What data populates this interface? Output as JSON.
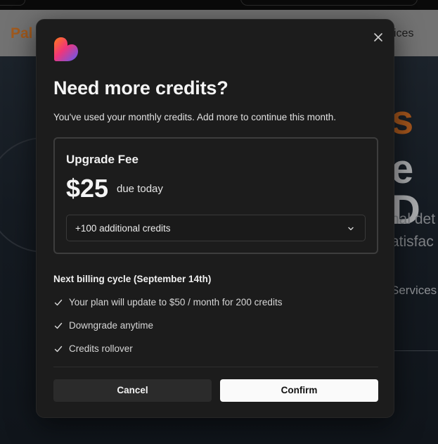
{
  "background": {
    "brand": "Pal",
    "nav_link": "ices",
    "hero_heading_1": "s",
    "hero_heading_2": "e D",
    "hero_body_1": "nal det",
    "hero_body_2": "atisfac",
    "hero_link": "Services"
  },
  "modal": {
    "title": "Need more credits?",
    "subtitle": "You've used your monthly credits. Add more to continue this month.",
    "fee_card": {
      "label": "Upgrade Fee",
      "amount": "$25",
      "due_text": "due today",
      "credits_option": "+100 additional credits"
    },
    "billing": {
      "title": "Next billing cycle (September 14th)",
      "features": [
        "Your plan will update to $50 / month for 200 credits",
        "Downgrade anytime",
        "Credits rollover"
      ]
    },
    "cancel_label": "Cancel",
    "confirm_label": "Confirm"
  },
  "icons": {
    "close": "close-icon",
    "logo": "heart-logo-icon",
    "chevron": "chevron-down-icon",
    "check": "check-icon"
  },
  "colors": {
    "modal_bg": "#1c1c1c",
    "confirm_bg": "#fafafa",
    "cancel_bg": "#2b2b2b",
    "brand_orange": "#a25a1d",
    "logo_gradient": [
      "#ff5a36",
      "#e0389a",
      "#5b5cf6"
    ]
  }
}
